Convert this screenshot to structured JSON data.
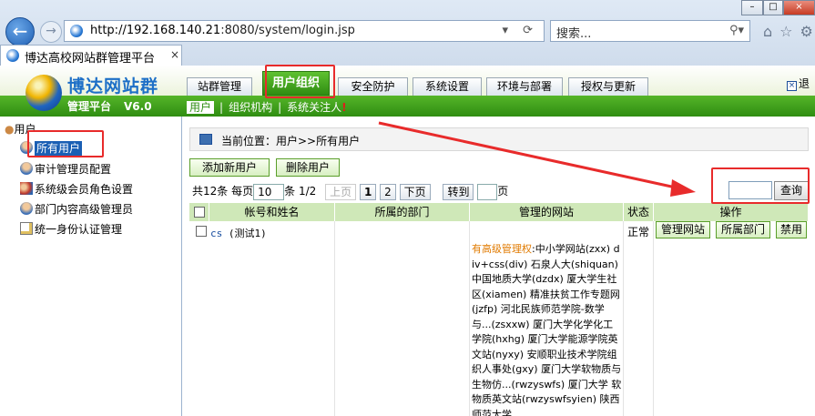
{
  "browser": {
    "url_host": "http://192.168.140.21",
    "url_rest": ":8080/system/login.jsp",
    "search_placeholder": "搜索...",
    "tab_title": "博达高校网站群管理平台",
    "tab_close": "×",
    "back_glyph": "←",
    "forward_glyph": "→",
    "window_buttons": {
      "minimize": "–",
      "maximize": "□",
      "close": "×"
    },
    "toolbar_icons": "⌂☆⚙"
  },
  "header": {
    "logo_text": "博达网站群",
    "logo_sub": "管理平台",
    "version": "V6.0",
    "logout": "退"
  },
  "nav": {
    "tabs": [
      "站群管理",
      "用户组织",
      "安全防护",
      "系统设置",
      "环境与部署",
      "授权与更新"
    ],
    "active": "用户组织"
  },
  "subnav": {
    "items": [
      "用户",
      "组织机构",
      "系统关注人"
    ],
    "alert": "!"
  },
  "sidebar": {
    "root": "用户",
    "items": [
      "所有用户",
      "审计管理员配置",
      "系统级会员角色设置",
      "部门内容高级管理员",
      "统一身份认证管理"
    ]
  },
  "breadcrumb": "当前位置：用户>>所有用户",
  "actions": {
    "add": "添加新用户",
    "delete": "删除用户"
  },
  "pager": {
    "total": "共12条",
    "per_page_label": "每页",
    "per_page": "10",
    "per_page_suffix": "条",
    "page_info": "1/2",
    "prev": "上页",
    "page1": "1",
    "page2": "2",
    "next": "下页",
    "goto": "转到",
    "page_suffix": "页"
  },
  "query_button": "查询",
  "table": {
    "headers": [
      "帐号和姓名",
      "所属的部门",
      "管理的网站",
      "状态",
      "操作"
    ],
    "row": {
      "account": "cs",
      "name": "(测试1)",
      "status": "正常",
      "buttons": [
        "管理网站",
        "所属部门",
        "禁用"
      ],
      "sites_label": "有高级管理权",
      "sites_text": ":中小学网站(zxx) div+css(div) 石泉人大(shiquan) 中国地质大学(dzdx) 厦大学生社区(xiamen) 精准扶贫工作专题网(jzfp) 河北民族师范学院-数学与...(zsxxw) 厦门大学化学化工学院(hxhg) 厦门大学能源学院英文站(nyxy) 安顺职业技术学院组织人事处(gxy) 厦门大学软物质与生物仿...(rwzyswfs) 厦门大学 软物质英文站(rwzyswfsyien) 陕西师范大学"
    }
  }
}
